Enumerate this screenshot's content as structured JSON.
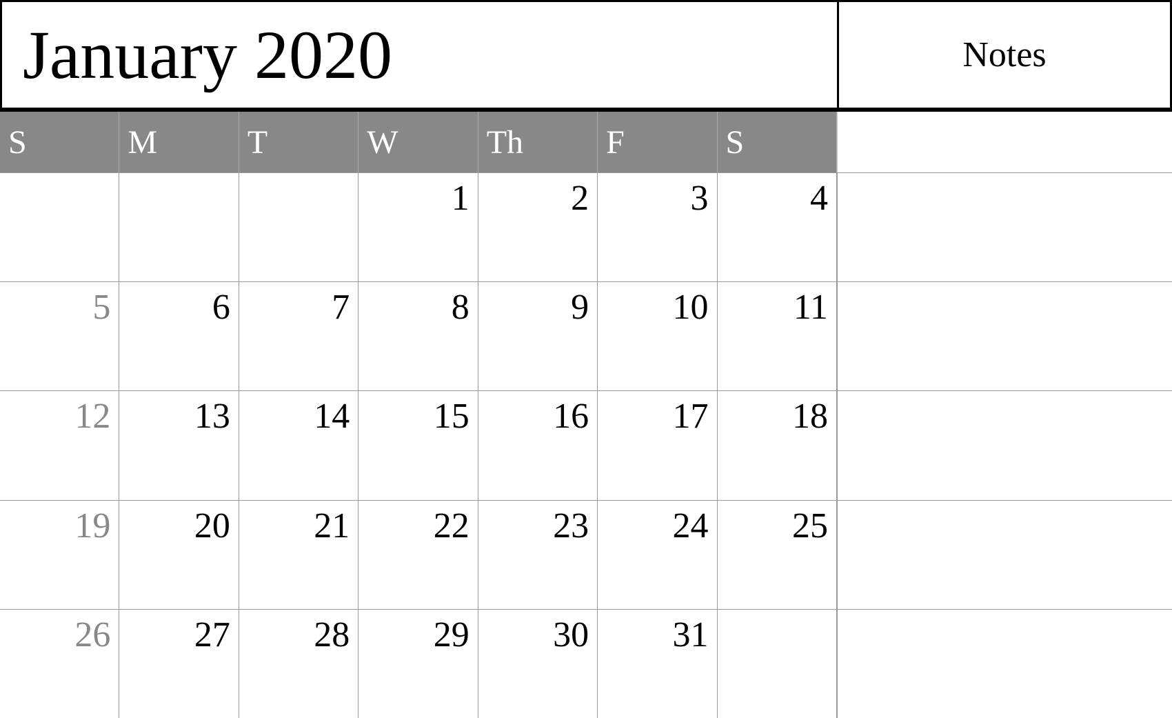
{
  "header": {
    "title": "January 2020",
    "notes_label": "Notes"
  },
  "days_of_week": [
    "S",
    "M",
    "T",
    "W",
    "Th",
    "F",
    "S"
  ],
  "weeks": [
    {
      "days": [
        {
          "number": "",
          "empty": true,
          "sunday": false
        },
        {
          "number": "",
          "empty": true,
          "sunday": false
        },
        {
          "number": "",
          "empty": true,
          "sunday": false
        },
        {
          "number": "1",
          "empty": false,
          "sunday": false
        },
        {
          "number": "2",
          "empty": false,
          "sunday": false
        },
        {
          "number": "3",
          "empty": false,
          "sunday": false
        },
        {
          "number": "4",
          "empty": false,
          "sunday": false
        }
      ]
    },
    {
      "days": [
        {
          "number": "5",
          "empty": false,
          "sunday": true
        },
        {
          "number": "6",
          "empty": false,
          "sunday": false
        },
        {
          "number": "7",
          "empty": false,
          "sunday": false
        },
        {
          "number": "8",
          "empty": false,
          "sunday": false
        },
        {
          "number": "9",
          "empty": false,
          "sunday": false
        },
        {
          "number": "10",
          "empty": false,
          "sunday": false
        },
        {
          "number": "11",
          "empty": false,
          "sunday": false
        }
      ]
    },
    {
      "days": [
        {
          "number": "12",
          "empty": false,
          "sunday": true
        },
        {
          "number": "13",
          "empty": false,
          "sunday": false
        },
        {
          "number": "14",
          "empty": false,
          "sunday": false
        },
        {
          "number": "15",
          "empty": false,
          "sunday": false
        },
        {
          "number": "16",
          "empty": false,
          "sunday": false
        },
        {
          "number": "17",
          "empty": false,
          "sunday": false
        },
        {
          "number": "18",
          "empty": false,
          "sunday": false
        }
      ]
    },
    {
      "days": [
        {
          "number": "19",
          "empty": false,
          "sunday": true
        },
        {
          "number": "20",
          "empty": false,
          "sunday": false
        },
        {
          "number": "21",
          "empty": false,
          "sunday": false
        },
        {
          "number": "22",
          "empty": false,
          "sunday": false
        },
        {
          "number": "23",
          "empty": false,
          "sunday": false
        },
        {
          "number": "24",
          "empty": false,
          "sunday": false
        },
        {
          "number": "25",
          "empty": false,
          "sunday": false
        }
      ]
    },
    {
      "days": [
        {
          "number": "26",
          "empty": false,
          "sunday": true
        },
        {
          "number": "27",
          "empty": false,
          "sunday": false
        },
        {
          "number": "28",
          "empty": false,
          "sunday": false
        },
        {
          "number": "29",
          "empty": false,
          "sunday": false
        },
        {
          "number": "30",
          "empty": false,
          "sunday": false
        },
        {
          "number": "31",
          "empty": false,
          "sunday": false
        },
        {
          "number": "",
          "empty": true,
          "sunday": false
        }
      ]
    }
  ]
}
